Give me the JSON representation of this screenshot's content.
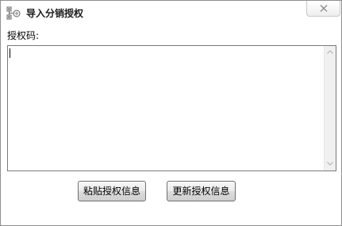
{
  "window": {
    "title": "导入分销授权",
    "icon": "network-icon",
    "close_icon": "close-icon"
  },
  "form": {
    "license_label": "授权码:",
    "license_value": ""
  },
  "buttons": {
    "paste_label": "粘贴授权信息",
    "update_label": "更新授权信息"
  },
  "colors": {
    "border": "#7a7a7a",
    "background": "#ffffff",
    "scrollbar": "#f0f0f0"
  }
}
